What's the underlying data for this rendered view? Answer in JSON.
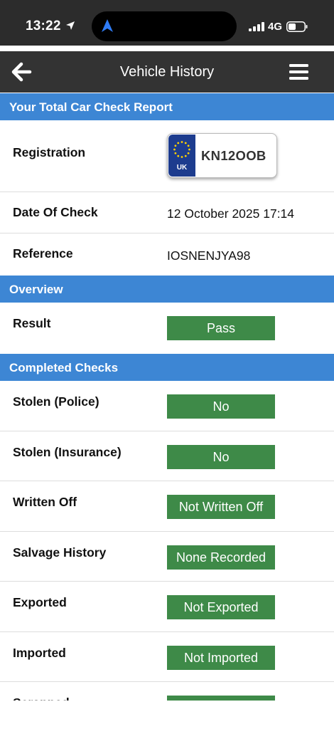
{
  "status_bar": {
    "time": "13:22",
    "network": "4G",
    "icons": [
      "location-arrow-icon",
      "signal-bars-icon",
      "battery-icon"
    ]
  },
  "nav": {
    "title": "Vehicle History",
    "back_icon": "back-arrow-icon",
    "menu_icon": "hamburger-menu-icon"
  },
  "report": {
    "header": "Your Total Car Check Report",
    "rows": {
      "registration": {
        "label": "Registration",
        "plate_country": "UK",
        "plate_number": "KN12OOB"
      },
      "date": {
        "label": "Date Of Check",
        "value": "12 October 2025 17:14"
      },
      "reference": {
        "label": "Reference",
        "value": "IOSNENJYA98"
      }
    }
  },
  "overview": {
    "header": "Overview",
    "result": {
      "label": "Result",
      "value": "Pass"
    }
  },
  "checks": {
    "header": "Completed Checks",
    "items": [
      {
        "label": "Stolen (Police)",
        "value": "No"
      },
      {
        "label": "Stolen (Insurance)",
        "value": "No"
      },
      {
        "label": "Written Off",
        "value": "Not Written Off"
      },
      {
        "label": "Salvage History",
        "value": "None Recorded"
      },
      {
        "label": "Exported",
        "value": "Not Exported"
      },
      {
        "label": "Imported",
        "value": "Not Imported"
      },
      {
        "label": "Scrapped",
        "value": ""
      }
    ]
  },
  "colors": {
    "section_header": "#3d86d4",
    "nav_bar": "#333333",
    "badge_green": "#3e8a48",
    "plate_band": "#1d3c8e",
    "eu_stars": "#ffd200"
  }
}
